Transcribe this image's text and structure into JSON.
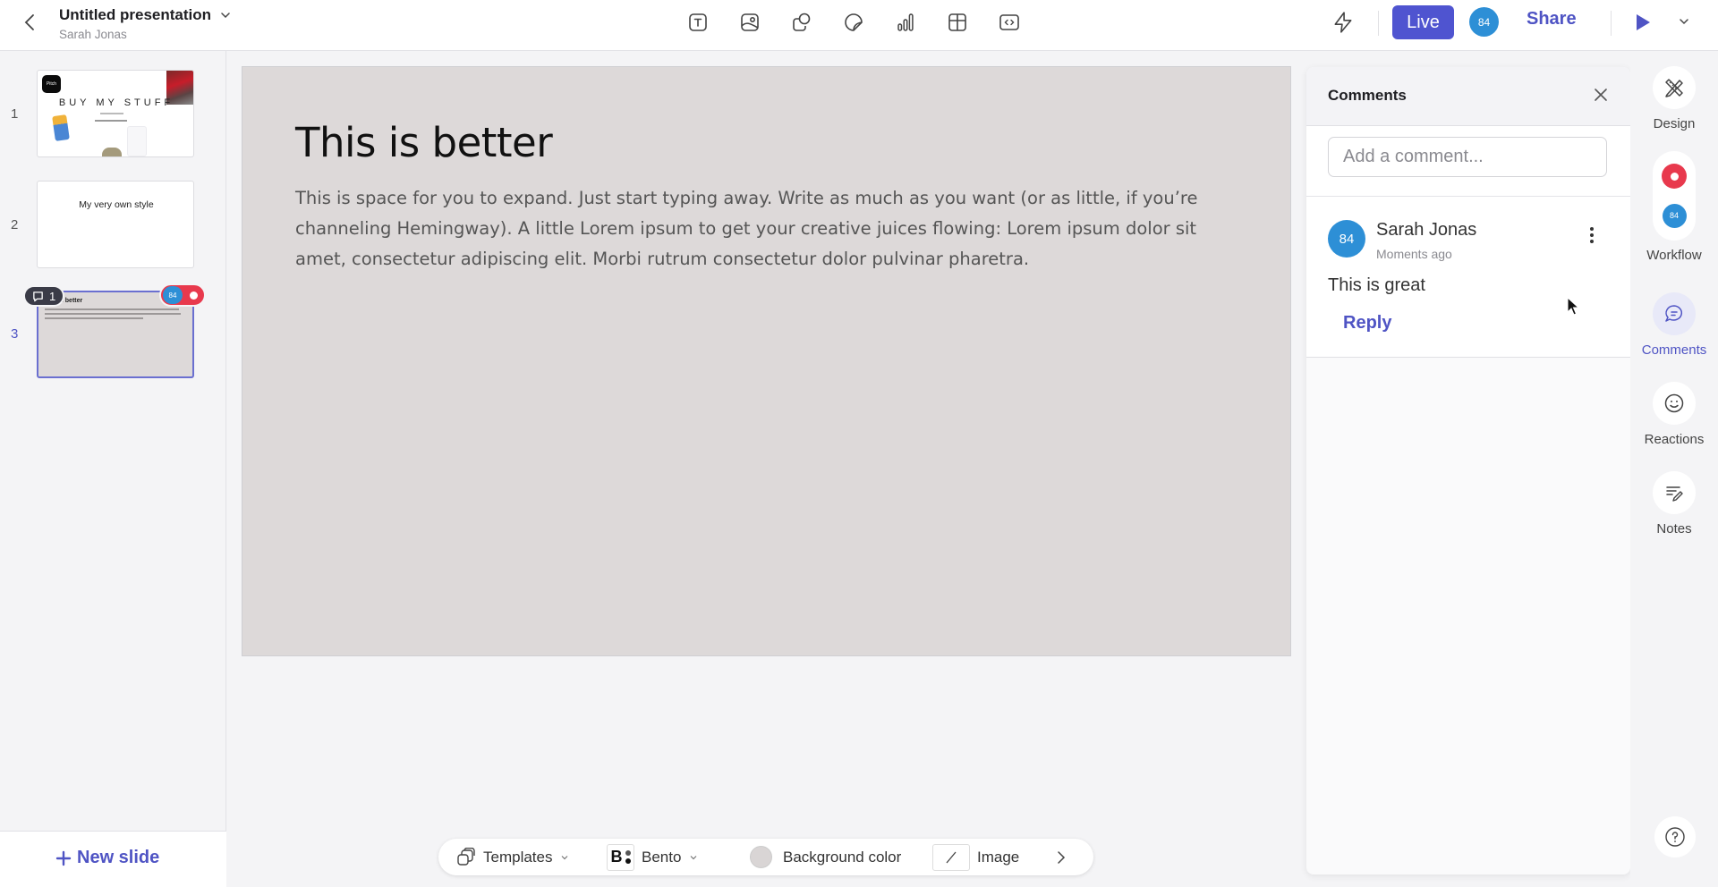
{
  "header": {
    "title": "Untitled presentation",
    "owner": "Sarah Jonas",
    "insert_tools": [
      {
        "name": "text-tool",
        "icon": "text-box-icon"
      },
      {
        "name": "image-tool",
        "icon": "image-icon"
      },
      {
        "name": "shape-tool",
        "icon": "shape-icon"
      },
      {
        "name": "sticker-tool",
        "icon": "sticker-icon"
      },
      {
        "name": "chart-tool",
        "icon": "bar-chart-icon"
      },
      {
        "name": "table-tool",
        "icon": "table-icon"
      },
      {
        "name": "embed-tool",
        "icon": "code-embed-icon"
      }
    ],
    "live_label": "Live",
    "user_avatar": "84",
    "share_label": "Share"
  },
  "slides": {
    "items": [
      {
        "number": "1",
        "title": "BUY MY STUFF",
        "logo_text": "Pitch"
      },
      {
        "number": "2",
        "title": "My very own style"
      },
      {
        "number": "3",
        "title": "is better",
        "active": true
      }
    ],
    "comment_badge_count": "1",
    "presence_avatar": "84",
    "new_slide_label": "New slide"
  },
  "slide": {
    "title": "This is better",
    "body": "This is space for you to expand. Just start typing away. Write as much as you want (or as little, if you’re channeling Hemingway). A little Lorem ipsum to get your creative juices flowing: Lorem ipsum dolor sit amet, consectetur adipiscing elit. Morbi rutrum consectetur dolor pulvinar pharetra."
  },
  "bottom_toolbar": {
    "templates_label": "Templates",
    "theme_letter": "B",
    "theme_label": "Bento",
    "background_label": "Background color",
    "background_color": "#d9d5d5",
    "image_label": "Image"
  },
  "comments_panel": {
    "title": "Comments",
    "input_placeholder": "Add a comment...",
    "comments": [
      {
        "avatar": "84",
        "author": "Sarah Jonas",
        "time": "Moments ago",
        "text": "This is great",
        "reply_label": "Reply"
      }
    ]
  },
  "right_rail": {
    "design_label": "Design",
    "workflow_label": "Workflow",
    "workflow_avatar": "84",
    "comments_label": "Comments",
    "reactions_label": "Reactions",
    "notes_label": "Notes"
  },
  "colors": {
    "accent": "#4f54c4",
    "live_button": "#4f54d0",
    "avatar": "#2d8fd6",
    "record": "#e8394d",
    "slide_background": "#ddd9d9"
  }
}
